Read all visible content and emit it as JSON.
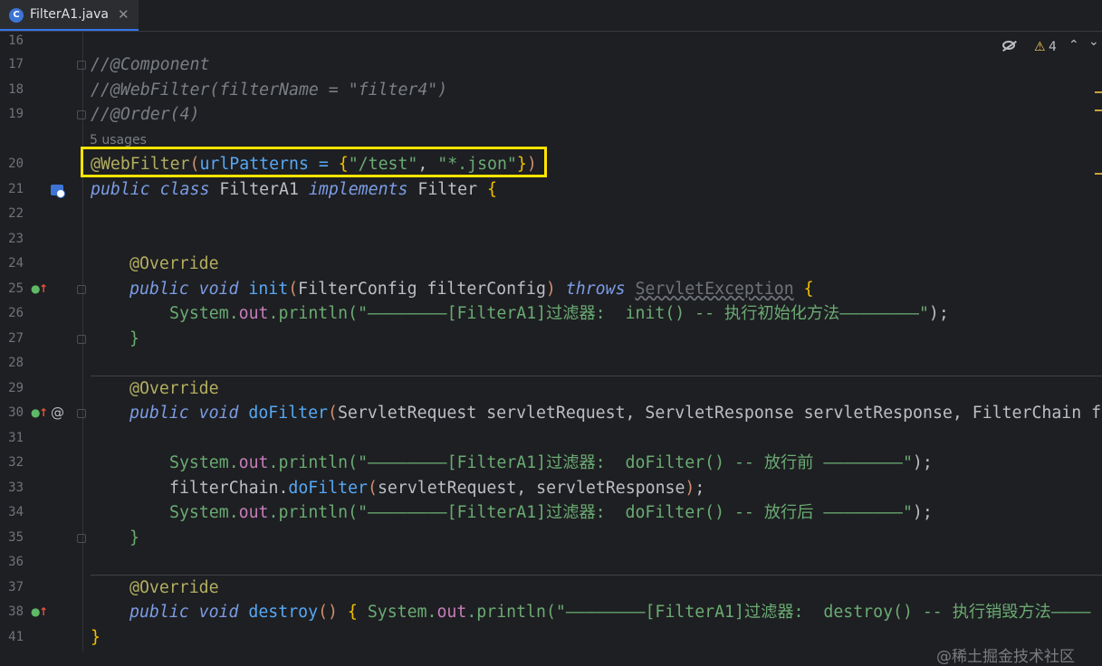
{
  "tab": {
    "title": "FilterA1.java",
    "icon_letter": "C",
    "close_glyph": "✕"
  },
  "inspection": {
    "eye_icon": "eye-crossed-icon",
    "warning_glyph": "⚠",
    "warning_count": "4",
    "up_glyph": "⌃",
    "down_glyph": "⌄"
  },
  "usages_label": "5 usages",
  "line_numbers": [
    "16",
    "17",
    "18",
    "19",
    "20",
    "21",
    "22",
    "23",
    "24",
    "25",
    "26",
    "27",
    "28",
    "29",
    "30",
    "31",
    "32",
    "33",
    "34",
    "35",
    "36",
    "37",
    "38",
    "41"
  ],
  "code": {
    "l17": "//@Component",
    "l18": "//@WebFilter(filterName = \"filter4\")",
    "l19": "//@Order(4)",
    "l20_ann": "@WebFilter",
    "l20_p1": "(",
    "l20_arg": "urlPatterns = ",
    "l20_b1": "{",
    "l20_s1": "\"/test\"",
    "l20_comma": ", ",
    "l20_s2": "\"*.json\"",
    "l20_b2": "}",
    "l20_p2": ")",
    "l21_kw": "public class ",
    "l21_name": "FilterA1 ",
    "l21_impl": "implements ",
    "l21_iface": "Filter ",
    "l21_brace": "{",
    "override": "@Override",
    "pub_void": "public void ",
    "l25_fn": "init",
    "l25_params": "FilterConfig filterConfig",
    "l25_throws": " throws ",
    "l25_exc": "ServletException",
    "sys": "System.",
    "out": "out",
    "println": ".println(",
    "l26_str": "\"————————[FilterA1]过滤器:  init() -- 执行初始化方法————————\"",
    "end_call": ");",
    "close_brace": "}",
    "l30_fn": "doFilter",
    "l30_params": "ServletRequest servletRequest, ServletResponse servletResponse, FilterChain f",
    "l32_str": "\"————————[FilterA1]过滤器:  doFilter() -- 放行前 ————————\"",
    "l33_obj": "filterChain.",
    "l33_fn": "doFilter",
    "l33_args": "servletRequest, servletResponse",
    "l34_str": "\"————————[FilterA1]过滤器:  doFilter() -- 放行后 ————————\"",
    "l38_fn": "destroy",
    "l38_str": "\"————————[FilterA1]过滤器:  destroy() -- 执行销毁方法————"
  },
  "watermark": "@稀土掘金技术社区",
  "colors": {
    "background": "#1e1f22",
    "highlight_box": "#ffe400",
    "keyword": "#7c9ce6",
    "string": "#6aab73",
    "annotation": "#b3ae60",
    "method": "#56a8f5",
    "field": "#c77dbb"
  }
}
